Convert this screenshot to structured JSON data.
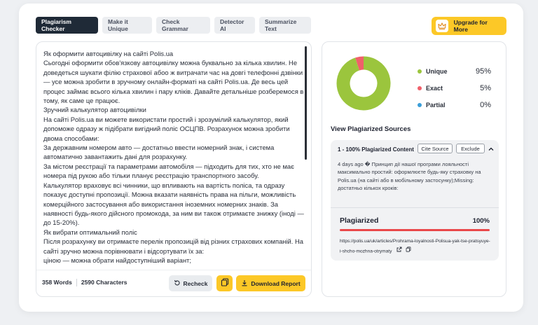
{
  "tabs": [
    {
      "label": "Plagiarism Checker",
      "active": true
    },
    {
      "label": "Make it Unique",
      "active": false
    },
    {
      "label": "Check Grammar",
      "active": false
    },
    {
      "label": "Detector AI",
      "active": false
    },
    {
      "label": "Summarize Text",
      "active": false
    }
  ],
  "upgrade": {
    "label": "Upgrade for More",
    "icon": "crown-icon"
  },
  "editor": {
    "paragraphs": [
      "Як оформити автоцивілку на сайті Polis.ua",
      "Сьогодні оформити обов'язкову автоцивілку можна буквально за кілька хвилин. Не доведеться шукати філію страхової абоо ж витрачати час на довгі телефонні дзвінки — усе можна зробити в зручному онлайн-форматі на сайті Polis.ua. Де весь цей процес займає всього кілька хвилин і пару кліків. Давайте детальніше розберемося в тому, як саме це працює.",
      "Зручний калькулятор автоцивілки",
      "На сайті Polis.ua ви можете використати простий і зрозумілий калькулятор, який допоможе одразу ж підібрати вигідний поліс ОСЦПВ. Розрахунок можна зробити двома способами:",
      "За державним номером авто — достатньо ввести номерний знак, і система автоматично завантажить дані для розрахунку.",
      "За містом реєстрації та параметрами автомобіля — підходить для тих, хто не має номера під рукою або тільки планує реєстрацію транспортного засобу.",
      "Калькулятор враховує всі чинники, що впливають на вартість поліса, та одразу показує доступні пропозиції. Можна вказати наявність права на пільги, можливість комерційного застосування або використання іноземних номерних знаків. За наявності будь-якого дійсного промокода, за ним ви також отримаєте знижку (іноді — до 15-20%).",
      "Як вибрати оптимальний поліс",
      "Після розрахунку ви отримаєте перелік пропозицій від різних страхових компаній. На сайті зручно можна порівнювати і відсортувати їх за:",
      "ціною — можна обрати найдоступніший варіант;"
    ],
    "word_count": "358 Words",
    "char_count": "2590 Characters",
    "recheck_label": "Recheck",
    "download_label": "Download Report"
  },
  "results": {
    "legend": [
      {
        "label": "Unique",
        "value": "95%",
        "color": "#9bc53d"
      },
      {
        "label": "Exact",
        "value": "5%",
        "color": "#f0606a"
      },
      {
        "label": "Partial",
        "value": "0%",
        "color": "#3b9ed8"
      }
    ],
    "chart_data": {
      "type": "pie",
      "categories": [
        "Unique",
        "Exact",
        "Partial"
      ],
      "values": [
        95,
        5,
        0
      ],
      "colors": [
        "#9bc53d",
        "#f0606a",
        "#3b9ed8"
      ]
    },
    "sources_title": "View Plagiarized Sources",
    "source": {
      "title": "1 - 100% Plagiarized Content",
      "cite_label": "Cite Source",
      "exclude_label": "Exclude",
      "snippet": "4 days ago � Принцип дії нашої програми лояльності максимально простий: оформлюєте будь-яку страховку на Polis.ua (на сайті або в мобільному застосунку);Missing: достатньо кількох кроків:",
      "plag_label": "Plagiarized",
      "plag_value": "100%",
      "plag_fraction": 1.0,
      "url": "https://polis.ua/uk/articles/Prohrama-loyalnosti-Polisua-yak-tse-pratsyuye-i-shcho-mozhna-otrymaty"
    }
  }
}
